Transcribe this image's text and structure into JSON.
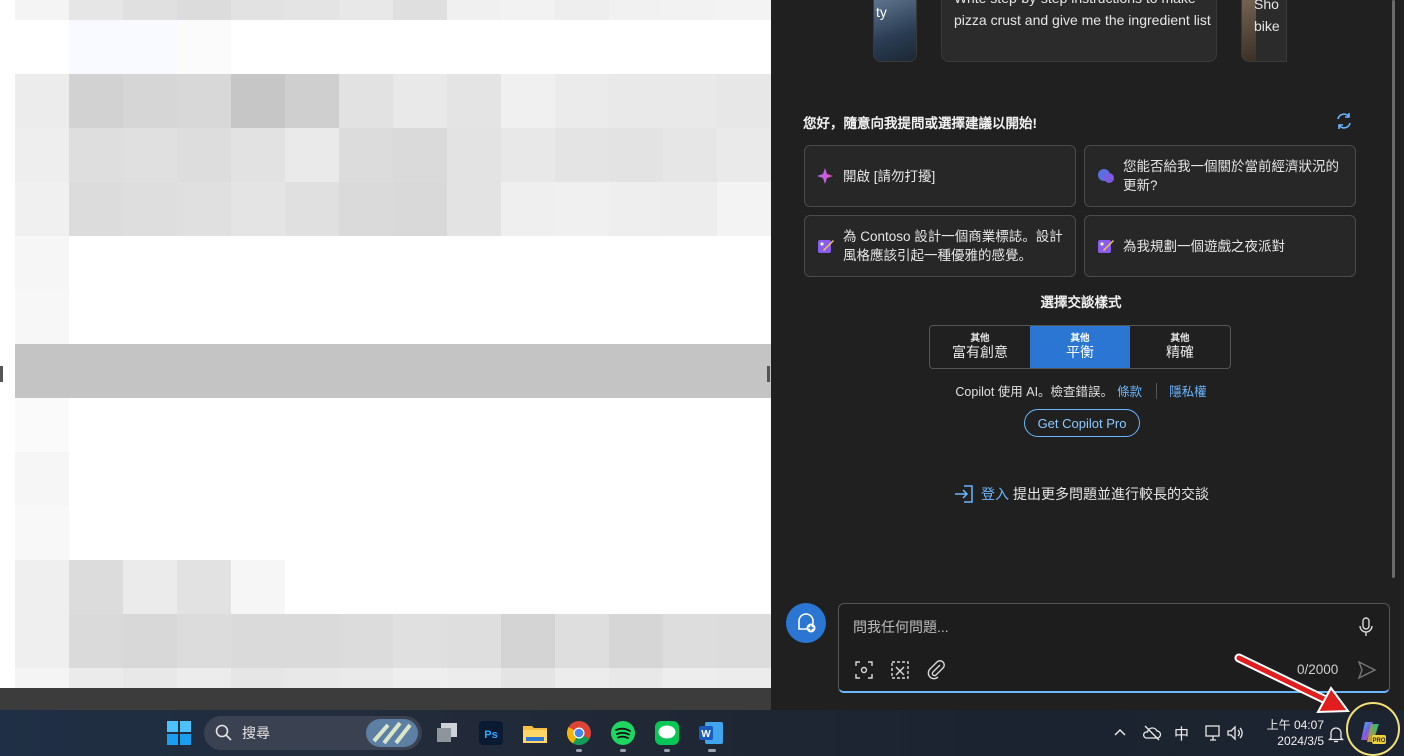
{
  "carousel": {
    "left_card_text": "ty",
    "center_card_text": "Write step-by-step instructions to make pizza crust and give me the ingredient list",
    "right_card_text": "Sho bike"
  },
  "copilot": {
    "greeting": "您好，隨意向我提問或選擇建議以開始!",
    "suggestions": [
      {
        "label": "開啟 [請勿打擾]",
        "icon": "sparkle-icon"
      },
      {
        "label": "您能否給我一個關於當前經濟狀況的更新?",
        "icon": "chat-bubbles-icon"
      },
      {
        "label": "為 Contoso 設計一個商業標誌。設計風格應該引起一種優雅的感覺。",
        "icon": "image-create-icon"
      },
      {
        "label": "為我規劃一個遊戲之夜派對",
        "icon": "image-create-icon"
      }
    ],
    "style_title": "選擇交談樣式",
    "tones": [
      {
        "small": "其他",
        "big": "富有創意"
      },
      {
        "small": "其他",
        "big": "平衡"
      },
      {
        "small": "其他",
        "big": "精確"
      }
    ],
    "active_tone": 1,
    "disclaimer_text": "Copilot 使用 AI。檢查錯誤。",
    "terms_link": "條款",
    "privacy_link": "隱私權",
    "get_pro": "Get Copilot Pro",
    "signin_link": "登入",
    "signin_text": "提出更多問題並進行較長的交談",
    "input_placeholder": "問我任何問題...",
    "char_counter": "0/2000"
  },
  "taskbar": {
    "search_label": "搜尋",
    "ime": "中",
    "time": "上午 04:07",
    "date": "2024/3/5",
    "apps": [
      "start-icon",
      "task-view-icon",
      "photoshop-icon",
      "file-explorer-icon",
      "chrome-icon",
      "spotify-icon",
      "line-icon",
      "word-icon"
    ]
  },
  "colors": {
    "accent": "#2a76d2",
    "link": "#6cb6ff",
    "panel_bg": "#202020",
    "highlight_circle": "#f2e07a",
    "arrow": "#e11d1d"
  }
}
